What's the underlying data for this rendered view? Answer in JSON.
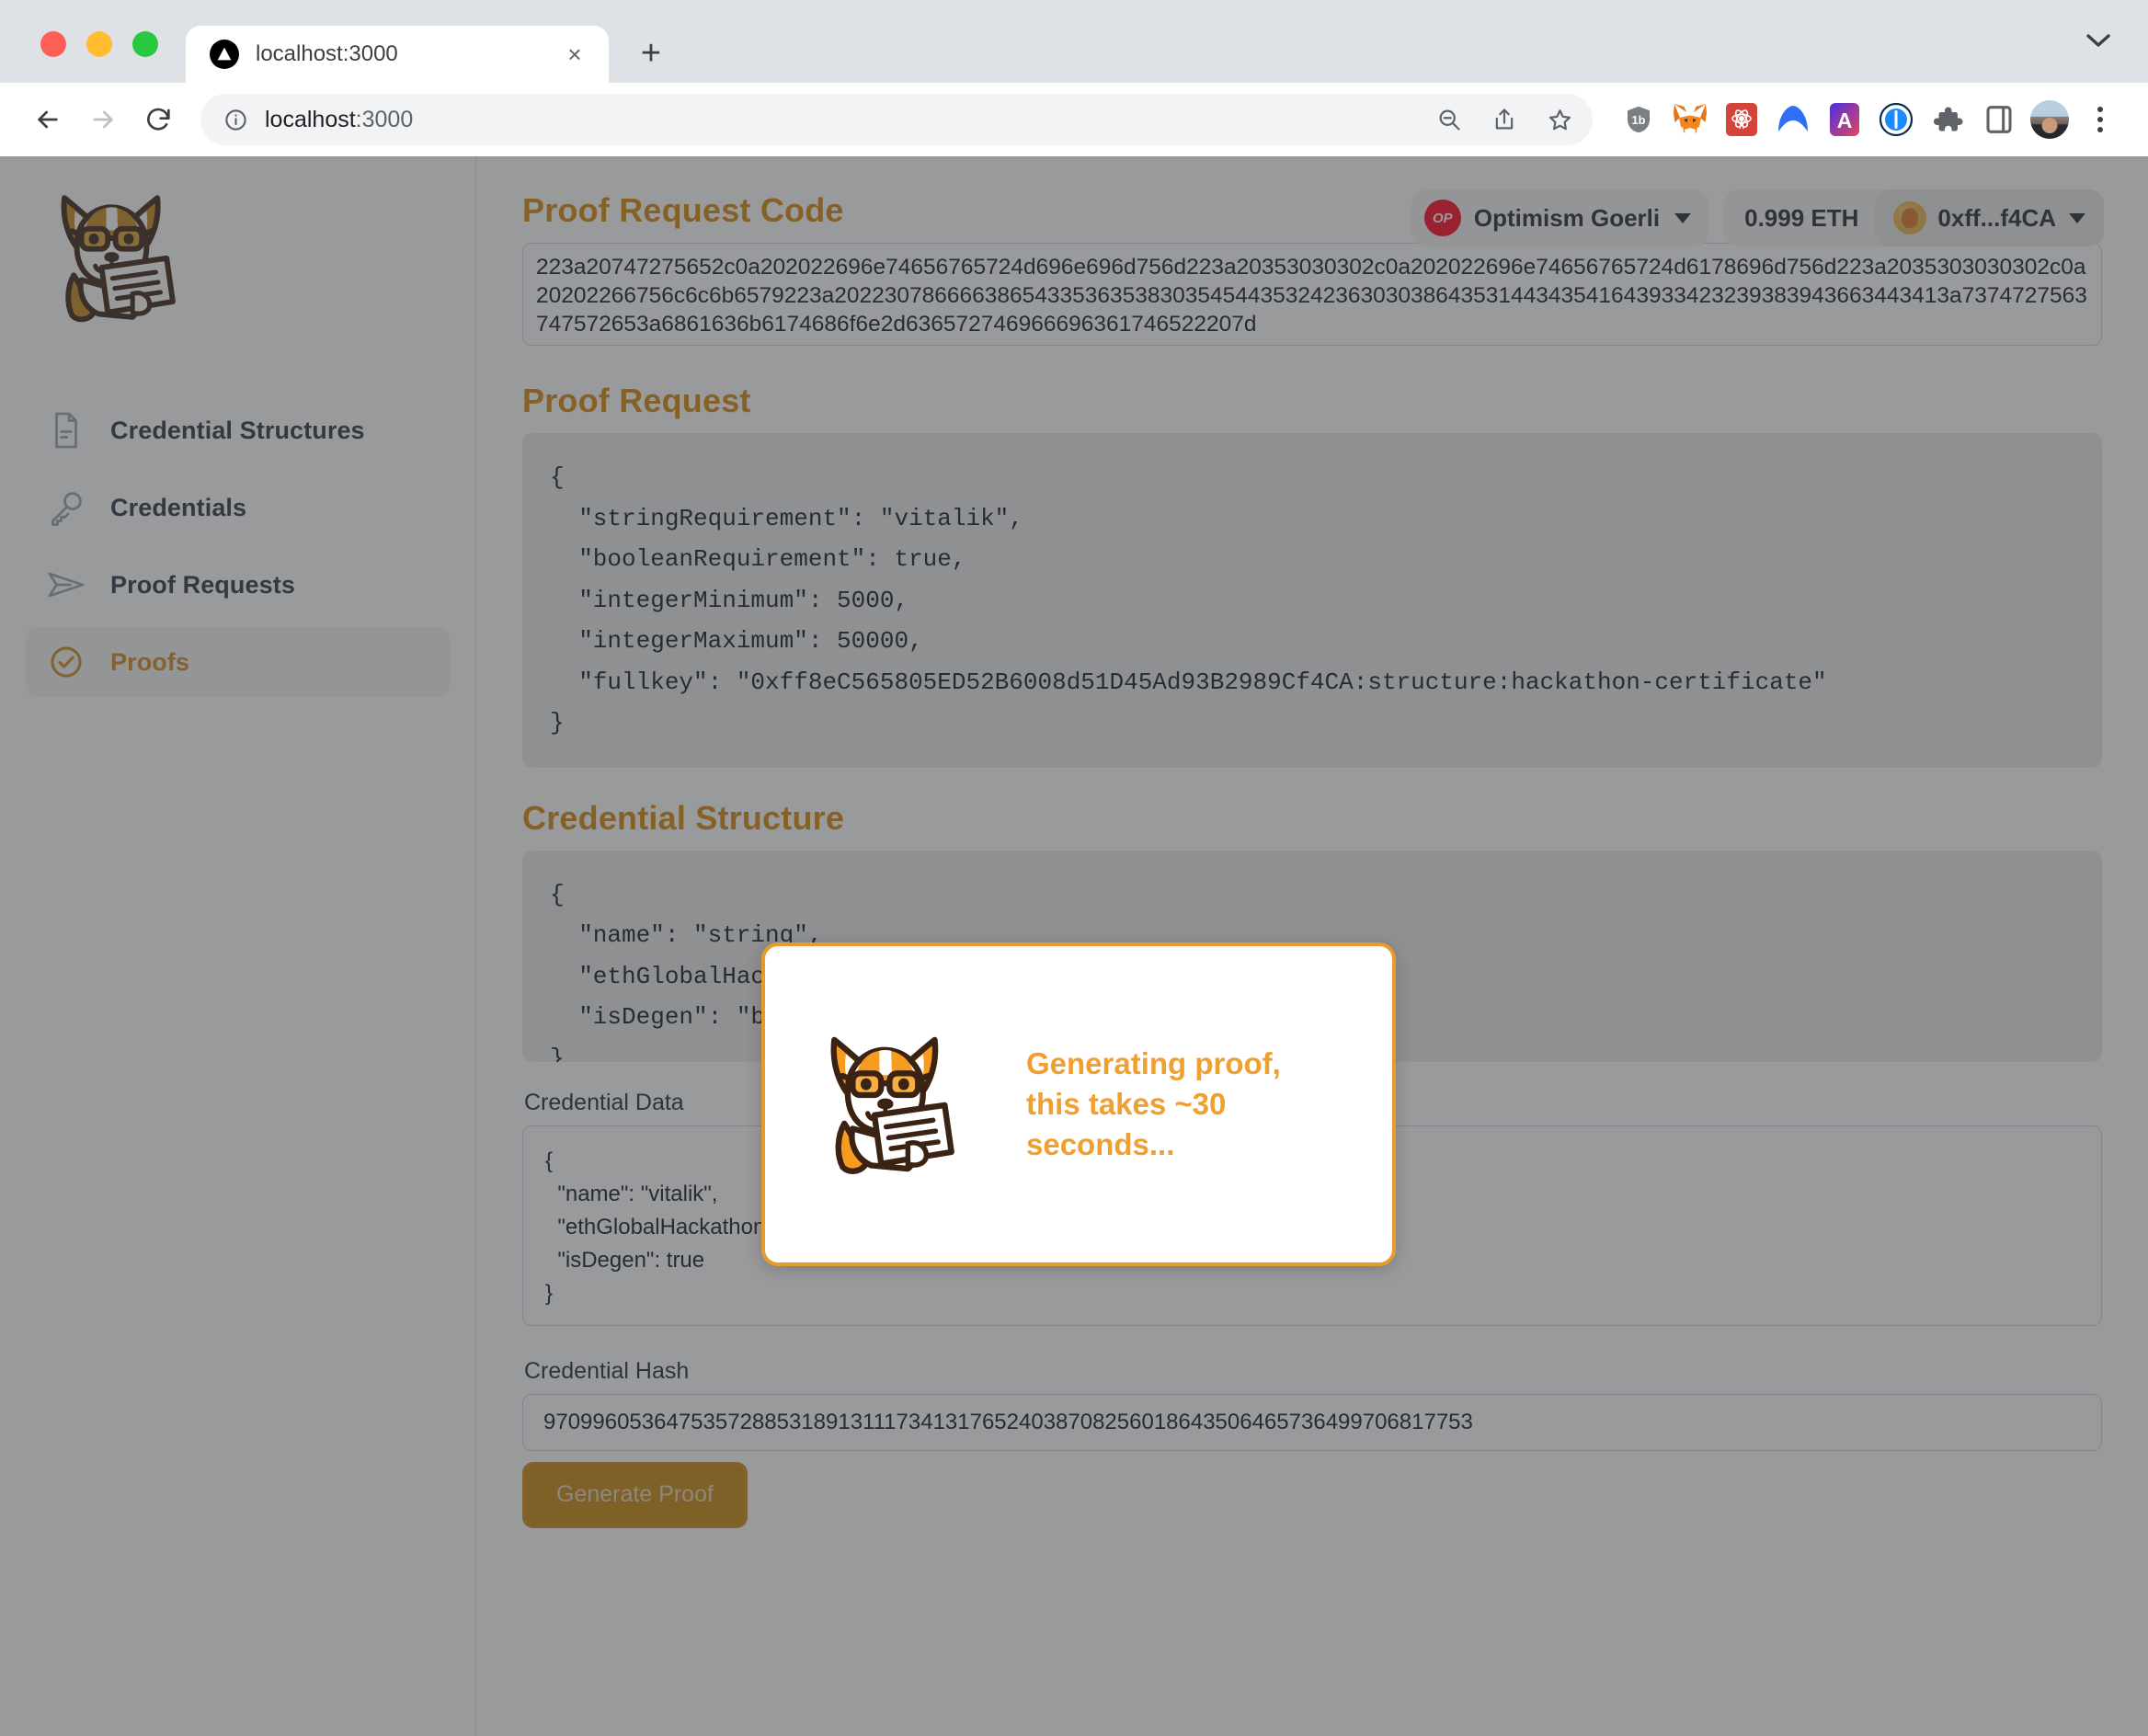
{
  "browser": {
    "tab": {
      "title": "localhost:3000",
      "favicon": "triangle-logo-icon",
      "close": "×"
    },
    "new_tab_label": "+",
    "tab_list_chevron": "chevron-down-icon",
    "omnibox": {
      "url_main": "localhost",
      "url_port": ":3000",
      "info_icon": "info-circle-icon"
    },
    "toolbar_icons": [
      "zoom-out-icon",
      "share-icon",
      "bookmark-star-icon",
      "shield-1blocker-icon",
      "metamask-fox-icon",
      "rabby-wallet-icon",
      "arc-extension-icon",
      "a-extension-icon",
      "1password-icon",
      "puzzle-extensions-icon",
      "side-panel-icon"
    ],
    "profile": "avatar",
    "menu": "three-dot-menu-icon"
  },
  "sidebar": {
    "logo": "corgi-reading-logo",
    "items": [
      {
        "label": "Credential Structures",
        "icon": "document-icon",
        "active": false
      },
      {
        "label": "Credentials",
        "icon": "key-icon",
        "active": false
      },
      {
        "label": "Proof Requests",
        "icon": "paper-plane-icon",
        "active": false
      },
      {
        "label": "Proofs",
        "icon": "check-circle-icon",
        "active": true
      }
    ]
  },
  "wallet": {
    "chain_badge": "OP",
    "chain_name": "Optimism Goerli",
    "chain_chevron": "chevron-down-icon",
    "balance": "0.999 ETH",
    "address_icon": "wallet-avatar-icon",
    "address": "0xff...f4CA",
    "address_chevron": "chevron-down-icon"
  },
  "main": {
    "proof_request_code_heading": "Proof Request Code",
    "proof_request_code_value": "223a20747275652c0a202022696e74656765724d696e696d756d223a20353030302c0a202022696e74656765724d6178696d756d223a2035303030302c0a20202266756c6c6b6579223a20223078666638654335363538303545443532423630303864353144343541643933423239383943663443413a7374727563747572653a6861636b6174686f6e2d636572746966696361746522207d",
    "proof_request_heading": "Proof Request",
    "proof_request_json": "{\n  \"stringRequirement\": \"vitalik\",\n  \"booleanRequirement\": true,\n  \"integerMinimum\": 5000,\n  \"integerMaximum\": 50000,\n  \"fullkey\": \"0xff8eC565805ED52B6008d51D45Ad93B2989Cf4CA:structure:hackathon-certificate\"\n}",
    "credential_structure_heading": "Credential Structure",
    "credential_structure_json": "{\n  \"name\": \"string\",\n  \"ethGlobalHackathonsAttended\": \"integer\",\n  \"isDegen\": \"boolean\"\n}",
    "credential_data_label": "Credential Data",
    "credential_data_value": "{\n  \"name\": \"vitalik\",\n  \"ethGlobalHackathonsAttended\": 9000,\n  \"isDegen\": true\n}",
    "credential_hash_label": "Credential Hash",
    "credential_hash_value": "9709960536475357288531891311173413176524038708256018643506465736499706817753",
    "generate_proof_button": "Generate Proof"
  },
  "modal": {
    "logo": "corgi-reading-logo",
    "message": "Generating proof, this takes ~30 seconds..."
  },
  "colors": {
    "accent": "#d68910",
    "modal_border": "#e89a2b",
    "modal_text": "#f0a030",
    "optimism_red": "#ff0420",
    "button_bg": "#c8860d"
  }
}
